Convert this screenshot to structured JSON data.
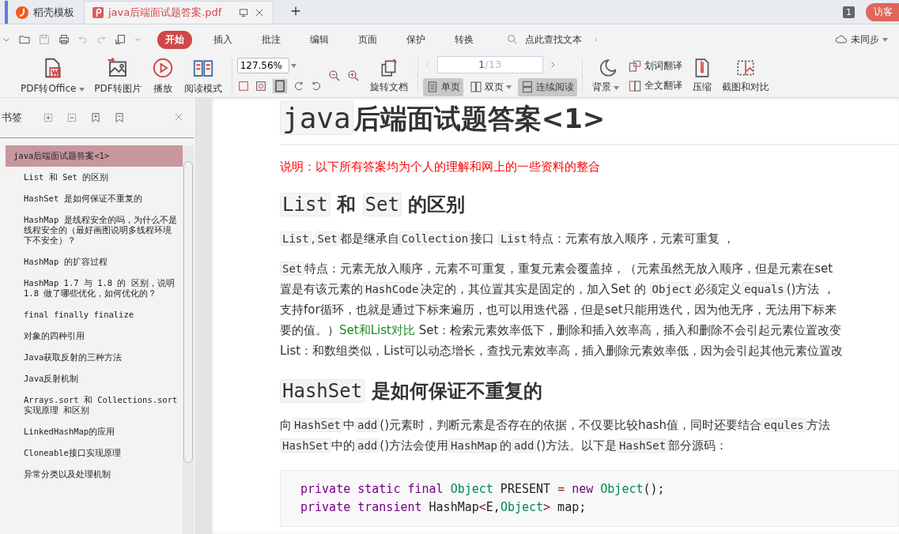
{
  "tabs": [
    {
      "label": "稻壳模板",
      "selected": false
    },
    {
      "label": "java后端面试题答案.pdf",
      "selected": true
    }
  ],
  "tab_bar_right": {
    "count": "1",
    "account": "访客"
  },
  "menu": [
    {
      "label": "开始",
      "selected": true
    },
    {
      "label": "插入",
      "selected": false
    },
    {
      "label": "批注",
      "selected": false
    },
    {
      "label": "编辑",
      "selected": false
    },
    {
      "label": "页面",
      "selected": false
    },
    {
      "label": "保护",
      "selected": false
    },
    {
      "label": "转换",
      "selected": false
    }
  ],
  "search": {
    "placeholder": "点此查找文本"
  },
  "sync": {
    "label": "未同步",
    "dropdown": true
  },
  "toolbar_left": [
    {
      "label": "PDF转Office",
      "dropdown": true
    },
    {
      "label": "PDF转图片",
      "dropdown": false
    },
    {
      "label": "播放",
      "dropdown": false
    },
    {
      "label": "阅读模式",
      "dropdown": false
    }
  ],
  "zoom": {
    "value": "127.56%",
    "dropdown": true
  },
  "rotate": "旋转文档",
  "page_nav": {
    "current": "1",
    "total": "/13"
  },
  "view_modes": [
    {
      "label": "单页",
      "selected": true,
      "dropdown": false
    },
    {
      "label": "双页",
      "selected": false,
      "dropdown": true
    },
    {
      "label": "连续阅读",
      "selected": true,
      "dropdown": false
    }
  ],
  "background": {
    "label": "背景",
    "dropdown": true
  },
  "translate": [
    "划词翻译",
    "全文翻译"
  ],
  "compress": "压缩",
  "screenshot": "截图和对比",
  "sidebar": {
    "title": "书签",
    "items": [
      {
        "label": "java后端面试题答案<1>",
        "selected": true,
        "children": [
          {
            "label": "List 和 Set 的区别",
            "selected": false
          },
          {
            "label": "HashSet 是如何保证不重复的",
            "selected": false
          },
          {
            "label": "HashMap 是线程安全的吗，为什么不是线程安全的（最好画图说明多线程环境下不安全）？",
            "selected": false
          },
          {
            "label": "HashMap 的扩容过程",
            "selected": false
          },
          {
            "label": "HashMap 1.7 与 1.8 的 区别，说明 1.8 做了哪些优化，如何优化的？",
            "selected": false
          },
          {
            "label": "final finally finalize",
            "selected": false
          },
          {
            "label": "对象的四种引用",
            "selected": false
          },
          {
            "label": "Java获取反射的三种方法",
            "selected": false
          },
          {
            "label": "Java反射机制",
            "selected": false
          },
          {
            "label": "Arrays.sort 和 Collections.sort 实现原理 和区别",
            "selected": false
          },
          {
            "label": "LinkedHashMap的应用",
            "selected": false
          },
          {
            "label": "Cloneable接口实现原理",
            "selected": false
          },
          {
            "label": "异常分类以及处理机制",
            "selected": false
          }
        ]
      }
    ]
  },
  "document": {
    "title": [
      {
        "kind": "code",
        "text": "java"
      },
      {
        "kind": "text",
        "text": "后端面试题答案<1>"
      }
    ],
    "note": "说明：以下所有答案均为个人的理解和网上的一些资料的整合",
    "blocks": [
      {
        "kind": "heading",
        "lines": [
          [
            {
              "kind": "code",
              "text": "List"
            },
            {
              "kind": "text",
              "text": " 和 "
            },
            {
              "kind": "code",
              "text": "Set"
            },
            {
              "kind": "text",
              "text": " 的区别"
            }
          ]
        ]
      },
      {
        "kind": "paragraph",
        "lines": [
          [
            {
              "kind": "code",
              "text": "List"
            },
            {
              "kind": "text",
              "text": ","
            },
            {
              "kind": "code",
              "text": "Set"
            },
            {
              "kind": "text",
              "text": "都是继承自"
            },
            {
              "kind": "code",
              "text": "Collection"
            },
            {
              "kind": "text",
              "text": "接口 "
            },
            {
              "kind": "code",
              "text": "List"
            },
            {
              "kind": "text",
              "text": "特点：元素有放入顺序，元素可重复 ，"
            }
          ]
        ]
      },
      {
        "kind": "paragraph",
        "lines": [
          [
            {
              "kind": "code",
              "text": "Set"
            },
            {
              "kind": "text",
              "text": "特点：元素无放入顺序，元素不可重复，重复元素会覆盖掉，（元素虽然无放入顺序，但是元素在set"
            }
          ],
          [
            {
              "kind": "text",
              "text": "置是有该元素的"
            },
            {
              "kind": "code",
              "text": "HashCode"
            },
            {
              "kind": "text",
              "text": "决定的，其位置其实是固定的，加入Set 的 "
            },
            {
              "kind": "code",
              "text": "Object"
            },
            {
              "kind": "text",
              "text": "必须定义"
            },
            {
              "kind": "code",
              "text": "equals"
            },
            {
              "kind": "text",
              "text": "()方法 ，"
            }
          ],
          [
            {
              "kind": "text",
              "text": "支持for循环，也就是通过下标来遍历，也可以用迭代器，但是set只能用迭代，因为他无序，无法用下标来"
            }
          ],
          [
            {
              "kind": "text",
              "text": "要的值。）"
            },
            {
              "kind": "link",
              "text": "Set和List对比"
            },
            {
              "kind": "text",
              "text": " Set：检索元素效率低下，删除和插入效率高，插入和删除不会引起元素位置改变"
            }
          ],
          [
            {
              "kind": "text",
              "text": "List：和数组类似，List可以动态增长，查找元素效率高，插入删除元素效率低，因为会引起其他元素位置改"
            }
          ]
        ]
      },
      {
        "kind": "heading",
        "lines": [
          [
            {
              "kind": "code",
              "text": "HashSet"
            },
            {
              "kind": "text",
              "text": " 是如何保证不重复的"
            }
          ]
        ]
      },
      {
        "kind": "paragraph",
        "lines": [
          [
            {
              "kind": "text",
              "text": "向"
            },
            {
              "kind": "code",
              "text": "HashSet"
            },
            {
              "kind": "text",
              "text": "中"
            },
            {
              "kind": "code",
              "text": "add"
            },
            {
              "kind": "text",
              "text": "()元素时，判断元素是否存在的依据，不仅要比较hash值，同时还要结合"
            },
            {
              "kind": "code",
              "text": "equles"
            },
            {
              "kind": "text",
              "text": "方法"
            }
          ],
          [
            {
              "kind": "code",
              "text": "HashSet"
            },
            {
              "kind": "text",
              "text": "中的"
            },
            {
              "kind": "code",
              "text": "add"
            },
            {
              "kind": "text",
              "text": "()方法会使用"
            },
            {
              "kind": "code",
              "text": "HashMap"
            },
            {
              "kind": "text",
              "text": "的"
            },
            {
              "kind": "code",
              "text": "add"
            },
            {
              "kind": "text",
              "text": "()方法。以下是"
            },
            {
              "kind": "code",
              "text": "HashSet"
            },
            {
              "kind": "text",
              "text": "部分源码："
            }
          ]
        ]
      },
      {
        "kind": "code_block",
        "lines": [
          [
            {
              "kind": "keyword",
              "text": "private static final "
            },
            {
              "kind": "type",
              "text": "Object"
            },
            {
              "kind": "plain",
              "text": " PRESENT "
            },
            {
              "kind": "op",
              "text": "="
            },
            {
              "kind": "keyword",
              "text": " new "
            },
            {
              "kind": "type",
              "text": "Object"
            },
            {
              "kind": "plain",
              "text": "();"
            }
          ],
          [
            {
              "kind": "keyword",
              "text": "private transient "
            },
            {
              "kind": "plain",
              "text": "HashMap"
            },
            {
              "kind": "op",
              "text": "<"
            },
            {
              "kind": "plain",
              "text": "E,"
            },
            {
              "kind": "type",
              "text": "Object"
            },
            {
              "kind": "op",
              "text": ">"
            },
            {
              "kind": "plain",
              "text": " map;"
            }
          ]
        ]
      }
    ]
  }
}
